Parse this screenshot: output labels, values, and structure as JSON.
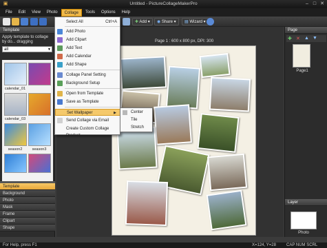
{
  "window": {
    "title": "Untitled - PictureCollageMakerPro"
  },
  "menubar": {
    "items": [
      "File",
      "Edit",
      "View",
      "Photo",
      "Collage",
      "Tools",
      "Options",
      "Help"
    ]
  },
  "toolbar": {
    "add_label": "Add",
    "share_label": "Share",
    "wizard_label": "Wizard"
  },
  "left_panel": {
    "title": "Template",
    "hint": "Apply template to collage by do... dragging",
    "filter_value": "all",
    "thumbnails": [
      "calendar_01",
      "calendar_03",
      "season2",
      "season3"
    ],
    "categories": [
      "Template",
      "Background",
      "Photo",
      "Mask",
      "Frame",
      "Clipart",
      "Shape"
    ]
  },
  "canvas": {
    "page_info": "Page 1 : 600 x 800 px, DPI: 300"
  },
  "collage_menu": {
    "items": [
      {
        "label": "Select All",
        "shortcut": "Ctrl+A"
      },
      {
        "label": "Add Photo"
      },
      {
        "label": "Add Clipart"
      },
      {
        "label": "Add Text"
      },
      {
        "label": "Add Calendar"
      },
      {
        "label": "Add Shape"
      },
      {
        "label": "Collage Panel Setting"
      },
      {
        "label": "Background Setup"
      },
      {
        "label": "Open from Template"
      },
      {
        "label": "Save as Template"
      },
      {
        "label": "Set Wallpaper"
      },
      {
        "label": "Send Collage via Email"
      },
      {
        "label": "Create Custom Collage Product"
      }
    ]
  },
  "wallpaper_submenu": {
    "items": [
      "Center",
      "Tile",
      "Stretch"
    ]
  },
  "right_panel": {
    "page_title": "Page",
    "page_thumb_label": "Page1",
    "layer_title": "Layer",
    "layer_item_label": "Photo"
  },
  "status": {
    "left": "For Help, press F1",
    "coords": "X=124, Y=28",
    "indicators": "CAP  NUM  SCRL"
  }
}
